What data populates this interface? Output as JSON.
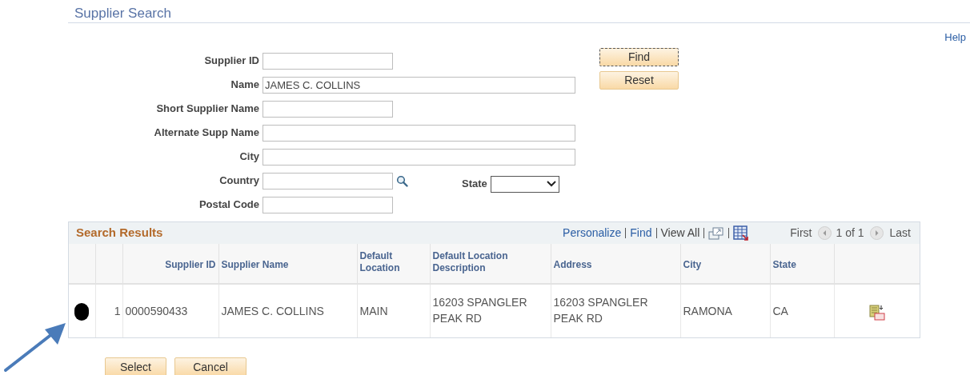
{
  "page": {
    "title": "Supplier Search",
    "help": "Help"
  },
  "fields": [
    {
      "kind": "short",
      "label": "Supplier ID"
    },
    {
      "kind": "long",
      "label": "Name",
      "value": "JAMES C. COLLINS"
    },
    {
      "kind": "short",
      "label": "Short Supplier Name"
    },
    {
      "kind": "long",
      "label": "Alternate Supp Name"
    },
    {
      "kind": "long",
      "label": "City"
    },
    {
      "kind": "lookup",
      "label": "Country",
      "side": {
        "label": "State"
      }
    },
    {
      "kind": "short",
      "label": "Postal Code"
    }
  ],
  "actions": [
    {
      "label": "Find",
      "focused": true
    },
    {
      "label": "Reset",
      "focused": false
    }
  ],
  "results": {
    "title": "Search Results",
    "links": [
      "Personalize",
      "Find",
      "View All"
    ],
    "pager": {
      "first": "First",
      "counter": "1 of 1",
      "last": "Last"
    },
    "columns": [
      {
        "label": "Supplier ID",
        "kind": "numeric"
      },
      {
        "label": "Supplier Name"
      },
      {
        "label": "Default Location"
      },
      {
        "label": "Default Location Description"
      },
      {
        "label": "Address"
      },
      {
        "label": "City"
      },
      {
        "label": "State"
      }
    ],
    "rows": [
      {
        "selected": true,
        "number": "1",
        "cells": [
          "0000590433",
          "JAMES C. COLLINS",
          "MAIN",
          "16203 SPANGLER PEAK RD",
          "16203 SPANGLER PEAK RD",
          "RAMONA",
          "CA"
        ]
      }
    ]
  },
  "bottom_buttons": [
    "Select",
    "Cancel"
  ]
}
